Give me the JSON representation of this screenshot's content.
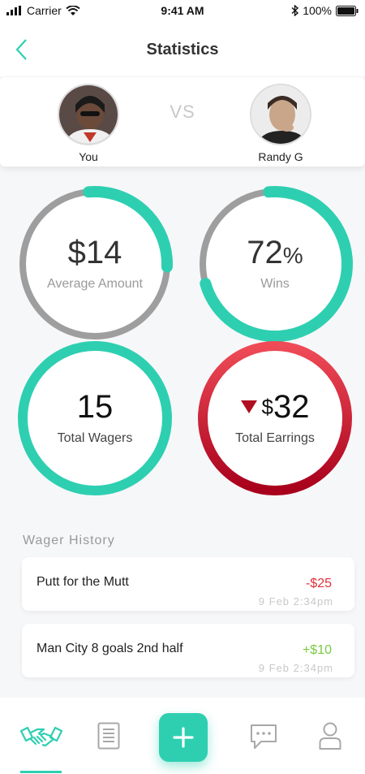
{
  "status_bar": {
    "carrier": "Carrier",
    "time": "9:41 AM",
    "battery": "100%"
  },
  "nav": {
    "title": "Statistics"
  },
  "versus": {
    "vs_label": "VS",
    "you": {
      "name": "You"
    },
    "opponent": {
      "name": "Randy G"
    }
  },
  "stats": {
    "average_amount": {
      "value": "$14",
      "label": "Average Amount",
      "progress": 0.27
    },
    "wins": {
      "value": "72",
      "unit": "%",
      "label": "Wins",
      "progress": 0.72
    },
    "total_wagers": {
      "value": "15",
      "label": "Total Wagers"
    },
    "total_earnings": {
      "currency": "$",
      "value": "32",
      "label": "Total Earrings",
      "trend": "down"
    }
  },
  "history": {
    "title": "Wager History",
    "items": [
      {
        "title": "Putt for the Mutt",
        "amount": "-$25",
        "time": "9 Feb 2:34pm"
      },
      {
        "title": "Man City 8 goals 2nd half",
        "amount": "+$10",
        "time": "9 Feb 2:34pm"
      }
    ]
  },
  "colors": {
    "accent": "#2ecfb1",
    "negative": "#e0303a",
    "positive": "#7ac943",
    "ring_track": "#9e9e9e",
    "earnings_ring": "#c8102e"
  },
  "tabs": [
    "handshake-icon",
    "document-icon",
    "plus-icon",
    "chat-icon",
    "profile-icon"
  ]
}
